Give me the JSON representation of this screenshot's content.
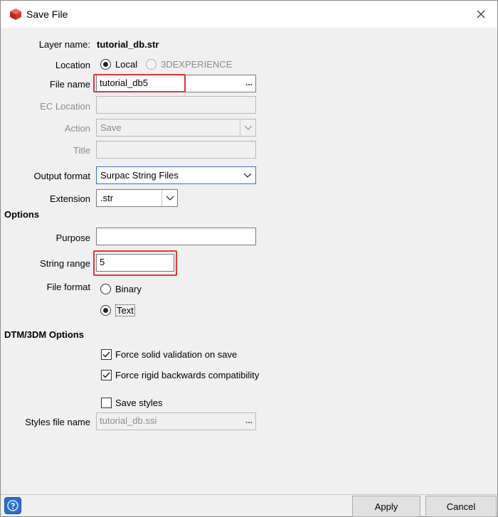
{
  "window": {
    "title": "Save File"
  },
  "form": {
    "layer_name_label": "Layer name:",
    "layer_name_value": "tutorial_db.str",
    "location_label": "Location",
    "location_local": "Local",
    "location_3dx": "3DEXPERIENCE",
    "file_name_label": "File name",
    "file_name_value": "tutorial_db5",
    "ec_location_label": "EC Location",
    "action_label": "Action",
    "action_value": "Save",
    "title_label": "Title",
    "output_format_label": "Output format",
    "output_format_value": "Surpac String Files",
    "extension_label": "Extension",
    "extension_value": ".str",
    "browse": "..."
  },
  "options": {
    "heading": "Options",
    "purpose_label": "Purpose",
    "string_range_label": "String range",
    "string_range_value": "5",
    "file_format_label": "File format",
    "binary": "Binary",
    "text": "Text"
  },
  "dtm": {
    "heading": "DTM/3DM Options",
    "force_solid": "Force solid validation on save",
    "force_rigid": "Force rigid backwards compatibility",
    "save_styles": "Save styles",
    "styles_file_label": "Styles file name",
    "styles_file_value": "tutorial_db.ssi"
  },
  "buttons": {
    "apply": "Apply",
    "cancel": "Cancel"
  },
  "colors": {
    "highlight": "#e0363a",
    "help": "#2d6fd1"
  }
}
